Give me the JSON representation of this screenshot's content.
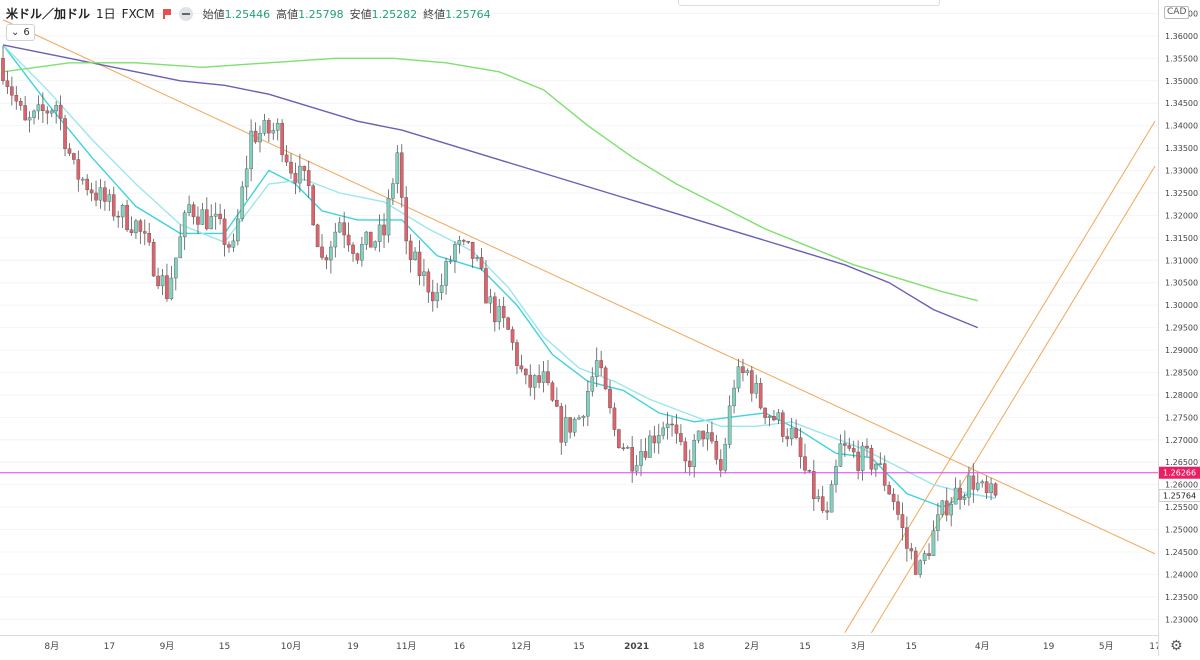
{
  "header": {
    "symbol": "米ドル／加ドル",
    "timeframe": "1日",
    "source": "FXCM",
    "ohlc": [
      {
        "label": "始値",
        "value": "1.25446"
      },
      {
        "label": "高値",
        "value": "1.25798"
      },
      {
        "label": "安値",
        "value": "1.25282"
      },
      {
        "label": "終値",
        "value": "1.25764"
      }
    ],
    "indicator_count": "6",
    "currency_badge": "CAD"
  },
  "colors": {
    "up": "#7fd1c0",
    "down": "#e0636b",
    "ma_short": "#3fd3dc",
    "ma_mid": "#9be6ef",
    "ma_green": "#7ee06e",
    "ma_purple": "#6a5fb6",
    "trendline": "#f2a65a",
    "hline": "#e040fb",
    "price_label_bg": "#e91e63",
    "last_label_bg": "#ffffff"
  },
  "chart_data": {
    "type": "candlestick",
    "y_axis": {
      "range": [
        1.2265,
        1.368
      ],
      "ticks": [
        "1.36500",
        "1.36000",
        "1.35500",
        "1.35000",
        "1.34500",
        "1.34000",
        "1.33500",
        "1.33000",
        "1.32500",
        "1.32000",
        "1.31500",
        "1.31000",
        "1.30500",
        "1.30000",
        "1.29500",
        "1.29000",
        "1.28500",
        "1.28000",
        "1.27500",
        "1.27000",
        "1.26500",
        "1.26000",
        "1.25500",
        "1.25000",
        "1.24500",
        "1.24000",
        "1.23500",
        "1.23000"
      ]
    },
    "x_axis": {
      "range_days": [
        0,
        260
      ],
      "tick_labels": [
        {
          "label": "8月",
          "day": 11
        },
        {
          "label": "17",
          "day": 24
        },
        {
          "label": "9月",
          "day": 37
        },
        {
          "label": "15",
          "day": 50
        },
        {
          "label": "10月",
          "day": 65
        },
        {
          "label": "19",
          "day": 79
        },
        {
          "label": "11月",
          "day": 91
        },
        {
          "label": "16",
          "day": 103
        },
        {
          "label": "12月",
          "day": 117
        },
        {
          "label": "15",
          "day": 130
        },
        {
          "label": "2021",
          "day": 143
        },
        {
          "label": "18",
          "day": 157
        },
        {
          "label": "2月",
          "day": 169
        },
        {
          "label": "15",
          "day": 181
        },
        {
          "label": "3月",
          "day": 193
        },
        {
          "label": "15",
          "day": 205
        },
        {
          "label": "4月",
          "day": 221
        },
        {
          "label": "19",
          "day": 236
        },
        {
          "label": "5月",
          "day": 249
        },
        {
          "label": "17",
          "day": 260
        }
      ]
    },
    "current_price": "1.25764",
    "horizontal_line": "1.26266",
    "candles_anchor": [
      [
        0,
        1.353
      ],
      [
        5,
        1.34
      ],
      [
        12,
        1.345
      ],
      [
        16,
        1.33
      ],
      [
        24,
        1.322
      ],
      [
        30,
        1.318
      ],
      [
        37,
        1.303
      ],
      [
        42,
        1.322
      ],
      [
        48,
        1.318
      ],
      [
        52,
        1.312
      ],
      [
        56,
        1.338
      ],
      [
        62,
        1.339
      ],
      [
        65,
        1.331
      ],
      [
        69,
        1.326
      ],
      [
        72,
        1.31
      ],
      [
        76,
        1.319
      ],
      [
        80,
        1.312
      ],
      [
        86,
        1.316
      ],
      [
        89,
        1.334
      ],
      [
        91,
        1.312
      ],
      [
        95,
        1.306
      ],
      [
        98,
        1.302
      ],
      [
        102,
        1.313
      ],
      [
        106,
        1.311
      ],
      [
        110,
        1.3
      ],
      [
        114,
        1.294
      ],
      [
        118,
        1.282
      ],
      [
        122,
        1.283
      ],
      [
        126,
        1.272
      ],
      [
        130,
        1.275
      ],
      [
        134,
        1.287
      ],
      [
        138,
        1.272
      ],
      [
        142,
        1.266
      ],
      [
        146,
        1.27
      ],
      [
        150,
        1.275
      ],
      [
        154,
        1.264
      ],
      [
        158,
        1.272
      ],
      [
        162,
        1.263
      ],
      [
        165,
        1.283
      ],
      [
        168,
        1.285
      ],
      [
        171,
        1.278
      ],
      [
        175,
        1.274
      ],
      [
        178,
        1.271
      ],
      [
        182,
        1.26
      ],
      [
        186,
        1.252
      ],
      [
        189,
        1.268
      ],
      [
        193,
        1.266
      ],
      [
        197,
        1.265
      ],
      [
        201,
        1.257
      ],
      [
        204,
        1.246
      ],
      [
        207,
        1.241
      ],
      [
        210,
        1.249
      ],
      [
        213,
        1.256
      ],
      [
        216,
        1.259
      ],
      [
        219,
        1.261
      ],
      [
        222,
        1.257
      ],
      [
        224,
        1.2576
      ]
    ],
    "moving_averages": [
      {
        "color": "#3fd3dc",
        "values": [
          [
            0,
            1.358
          ],
          [
            10,
            1.345
          ],
          [
            20,
            1.333
          ],
          [
            30,
            1.322
          ],
          [
            40,
            1.316
          ],
          [
            50,
            1.316
          ],
          [
            60,
            1.33
          ],
          [
            66,
            1.327
          ],
          [
            72,
            1.321
          ],
          [
            80,
            1.319
          ],
          [
            90,
            1.319
          ],
          [
            98,
            1.311
          ],
          [
            108,
            1.308
          ],
          [
            116,
            1.3
          ],
          [
            124,
            1.289
          ],
          [
            132,
            1.283
          ],
          [
            140,
            1.281
          ],
          [
            148,
            1.276
          ],
          [
            156,
            1.274
          ],
          [
            164,
            1.275
          ],
          [
            172,
            1.276
          ],
          [
            180,
            1.272
          ],
          [
            188,
            1.267
          ],
          [
            196,
            1.266
          ],
          [
            204,
            1.258
          ],
          [
            212,
            1.255
          ],
          [
            218,
            1.258
          ],
          [
            224,
            1.257
          ]
        ]
      },
      {
        "color": "#9be6ef",
        "values": [
          [
            0,
            1.358
          ],
          [
            10,
            1.348
          ],
          [
            20,
            1.337
          ],
          [
            30,
            1.327
          ],
          [
            40,
            1.318
          ],
          [
            50,
            1.314
          ],
          [
            60,
            1.327
          ],
          [
            68,
            1.328
          ],
          [
            76,
            1.325
          ],
          [
            86,
            1.323
          ],
          [
            96,
            1.317
          ],
          [
            106,
            1.312
          ],
          [
            114,
            1.304
          ],
          [
            122,
            1.293
          ],
          [
            130,
            1.286
          ],
          [
            138,
            1.283
          ],
          [
            146,
            1.279
          ],
          [
            154,
            1.276
          ],
          [
            162,
            1.273
          ],
          [
            170,
            1.273
          ],
          [
            178,
            1.274
          ],
          [
            186,
            1.271
          ],
          [
            194,
            1.268
          ],
          [
            202,
            1.264
          ],
          [
            210,
            1.26
          ],
          [
            218,
            1.258
          ],
          [
            224,
            1.257
          ]
        ]
      },
      {
        "color": "#6a5fb6",
        "values": [
          [
            0,
            1.358
          ],
          [
            15,
            1.355
          ],
          [
            30,
            1.352
          ],
          [
            40,
            1.35
          ],
          [
            50,
            1.349
          ],
          [
            60,
            1.347
          ],
          [
            70,
            1.344
          ],
          [
            80,
            1.341
          ],
          [
            90,
            1.339
          ],
          [
            100,
            1.336
          ],
          [
            110,
            1.333
          ],
          [
            120,
            1.33
          ],
          [
            130,
            1.327
          ],
          [
            140,
            1.324
          ],
          [
            150,
            1.321
          ],
          [
            160,
            1.318
          ],
          [
            170,
            1.315
          ],
          [
            180,
            1.312
          ],
          [
            190,
            1.309
          ],
          [
            200,
            1.305
          ],
          [
            210,
            1.299
          ],
          [
            220,
            1.295
          ]
        ]
      },
      {
        "color": "#7ee06e",
        "values": [
          [
            0,
            1.352
          ],
          [
            15,
            1.354
          ],
          [
            30,
            1.354
          ],
          [
            45,
            1.353
          ],
          [
            60,
            1.354
          ],
          [
            75,
            1.355
          ],
          [
            88,
            1.355
          ],
          [
            100,
            1.354
          ],
          [
            112,
            1.352
          ],
          [
            122,
            1.348
          ],
          [
            132,
            1.34
          ],
          [
            142,
            1.333
          ],
          [
            152,
            1.327
          ],
          [
            162,
            1.322
          ],
          [
            172,
            1.317
          ],
          [
            182,
            1.313
          ],
          [
            192,
            1.309
          ],
          [
            202,
            1.306
          ],
          [
            212,
            1.303
          ],
          [
            220,
            1.301
          ]
        ]
      }
    ],
    "trendlines": [
      {
        "from": [
          0,
          1.3636
        ],
        "to": [
          260,
          1.2446
        ]
      },
      {
        "from": [
          190,
          1.227
        ],
        "to": [
          260,
          1.341
        ]
      },
      {
        "from": [
          196,
          1.227
        ],
        "to": [
          260,
          1.331
        ]
      }
    ]
  }
}
